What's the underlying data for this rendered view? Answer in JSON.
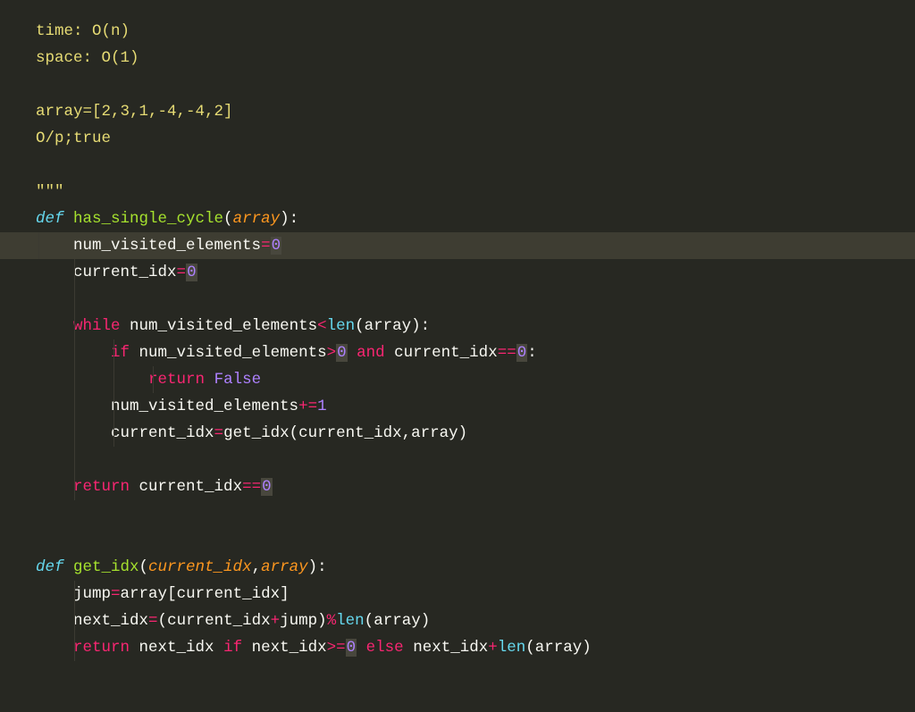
{
  "lines": {
    "l1": "time: O(n)",
    "l2": "space: O(1)",
    "l3": "",
    "l4": "array=[2,3,1,-4,-4,2]",
    "l5": "O/p;true",
    "l6": "",
    "l7": "\"\"\"",
    "l8_def": "def",
    "l8_name": " has_single_cycle",
    "l8_p1": "(",
    "l8_param": "array",
    "l8_p2": "):",
    "l9_indent": "    ",
    "l9_var": "num_visited_elements",
    "l9_op": "=",
    "l9_num": "0",
    "l10_indent": "    ",
    "l10_var": "current_idx",
    "l10_op": "=",
    "l10_num": "0",
    "l11": "",
    "l12_indent": "    ",
    "l12_while": "while",
    "l12_sp": " ",
    "l12_var": "num_visited_elements",
    "l12_op": "<",
    "l12_len": "len",
    "l12_p1": "(",
    "l12_arg": "array",
    "l12_p2": "):",
    "l13_indent": "        ",
    "l13_if": "if",
    "l13_sp": " ",
    "l13_var": "num_visited_elements",
    "l13_op": ">",
    "l13_num": "0",
    "l13_sp2": " ",
    "l13_and": "and",
    "l13_sp3": " ",
    "l13_var2": "current_idx",
    "l13_eq": "==",
    "l13_num2": "0",
    "l13_col": ":",
    "l14_indent": "            ",
    "l14_ret": "return",
    "l14_sp": " ",
    "l14_false": "False",
    "l15_indent": "        ",
    "l15_var": "num_visited_elements",
    "l15_op": "+=",
    "l15_num": "1",
    "l16_indent": "        ",
    "l16_var": "current_idx",
    "l16_op": "=",
    "l16_fn": "get_idx",
    "l16_p1": "(",
    "l16_a1": "current_idx",
    "l16_c": ",",
    "l16_a2": "array",
    "l16_p2": ")",
    "l17": "",
    "l18_indent": "    ",
    "l18_ret": "return",
    "l18_sp": " ",
    "l18_var": "current_idx",
    "l18_eq": "==",
    "l18_num": "0",
    "l19": "",
    "l20": "",
    "l21_def": "def",
    "l21_name": " get_idx",
    "l21_p1": "(",
    "l21_param1": "current_idx",
    "l21_c": ",",
    "l21_param2": "array",
    "l21_p2": "):",
    "l22_indent": "    ",
    "l22_var": "jump",
    "l22_op": "=",
    "l22_var2": "array",
    "l22_b1": "[",
    "l22_idx": "current_idx",
    "l22_b2": "]",
    "l23_indent": "    ",
    "l23_var": "next_idx",
    "l23_op": "=",
    "l23_p1": "(",
    "l23_a1": "current_idx",
    "l23_plus": "+",
    "l23_a2": "jump",
    "l23_p2": ")",
    "l23_mod": "%",
    "l23_len": "len",
    "l23_p3": "(",
    "l23_a3": "array",
    "l23_p4": ")",
    "l24_indent": "    ",
    "l24_ret": "return",
    "l24_sp": " ",
    "l24_var": "next_idx",
    "l24_sp2": " ",
    "l24_if": "if",
    "l24_sp3": " ",
    "l24_var2": "next_idx",
    "l24_op": ">=",
    "l24_num": "0",
    "l24_sp4": " ",
    "l24_else": "else",
    "l24_sp5": " ",
    "l24_var3": "next_idx",
    "l24_plus": "+",
    "l24_len": "len",
    "l24_p1": "(",
    "l24_a1": "array",
    "l24_p2": ")"
  }
}
